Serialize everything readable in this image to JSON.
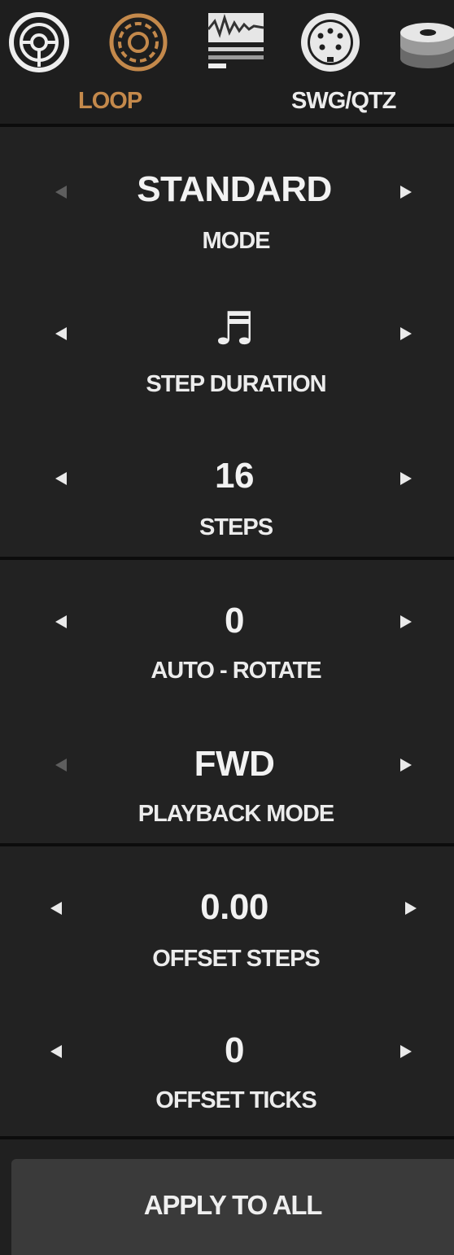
{
  "tabs": [
    {
      "name": "steering-wheel-icon",
      "label": ""
    },
    {
      "name": "loop-icon",
      "label": "LOOP",
      "active": true
    },
    {
      "name": "waveform-icon",
      "label": ""
    },
    {
      "name": "midi-connector-icon",
      "label": "SWG/QTZ"
    },
    {
      "name": "stack-disc-icon",
      "label": ""
    }
  ],
  "colors": {
    "accent": "#c4894b",
    "background": "#202020",
    "divider": "#0c0c0c",
    "button": "#3a3a3a"
  },
  "params": {
    "mode": {
      "value": "STANDARD",
      "label": "MODE"
    },
    "step_duration": {
      "value": "",
      "icon": "sixteenth-note-icon",
      "glyph": "♬",
      "label": "STEP DURATION"
    },
    "steps": {
      "value": "16",
      "label": "STEPS"
    },
    "auto_rotate": {
      "value": "0",
      "label": "AUTO - ROTATE"
    },
    "playback_mode": {
      "value": "FWD",
      "label": "PLAYBACK MODE"
    },
    "offset_steps": {
      "value": "0.00",
      "label": "OFFSET STEPS"
    },
    "offset_ticks": {
      "value": "0",
      "label": "OFFSET TICKS"
    }
  },
  "apply_button": {
    "label": "APPLY TO ALL"
  }
}
